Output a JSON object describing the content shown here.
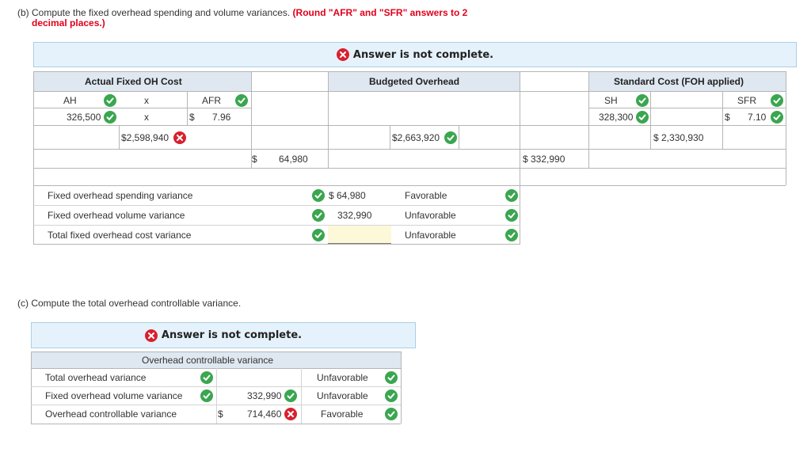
{
  "part_b": {
    "prefix": "(b) Compute the fixed overhead spending and volume variances.",
    "note_line1": "(Round \"AFR\" and \"SFR\" answers to 2",
    "note_line2": "decimal places.)",
    "banner": "Answer is not complete.",
    "headers": {
      "actual": "Actual Fixed OH Cost",
      "budgeted": "Budgeted Overhead",
      "standard": "Standard Cost (FOH applied)"
    },
    "ah_label": "AH",
    "x1": "x",
    "afr_label": "AFR",
    "ah_value": "326,500",
    "x2": "x",
    "dollar_afr": "$",
    "afr_value": "7.96",
    "actual_total": "$2,598,940",
    "budget_total": "$2,663,920",
    "sh_label": "SH",
    "sfr_label": "SFR",
    "sh_value": "328,300",
    "dollar_sfr": "$",
    "sfr_value": "7.10",
    "standard_total": "$ 2,330,930",
    "diff1_dollar": "$",
    "diff1_value": "64,980",
    "diff2": "$  332,990",
    "variances": [
      {
        "label": "Fixed overhead spending variance",
        "amount": "$ 64,980",
        "type": "Favorable"
      },
      {
        "label": "Fixed overhead volume variance",
        "amount": "332,990",
        "type": "Unfavorable"
      },
      {
        "label": "Total fixed overhead cost variance",
        "amount": "",
        "type": "Unfavorable"
      }
    ]
  },
  "part_c": {
    "question": "(c) Compute the total overhead controllable variance.",
    "banner": "Answer is not complete.",
    "header": "Overhead controllable variance",
    "rows": [
      {
        "label": "Total overhead variance",
        "dollar": "",
        "amount": "",
        "type": "Unfavorable"
      },
      {
        "label": "Fixed overhead volume variance",
        "dollar": "",
        "amount": "332,990",
        "type": "Unfavorable"
      },
      {
        "label": "Overhead controllable variance",
        "dollar": "$",
        "amount": "714,460",
        "type": "Favorable"
      }
    ]
  },
  "colors": {
    "correct": "#3aa64f",
    "incorrect": "#d9202e",
    "banner_bg": "#e6f2fb",
    "header_bg": "#dfe7f1"
  }
}
